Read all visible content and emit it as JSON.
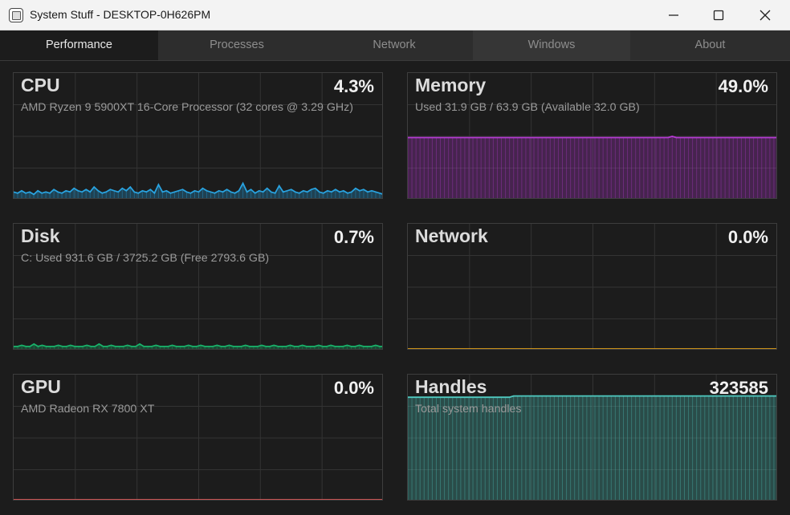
{
  "window": {
    "title": "System Stuff - DESKTOP-0H626PM"
  },
  "tabs": [
    {
      "label": "Performance",
      "active": true
    },
    {
      "label": "Processes"
    },
    {
      "label": "Network"
    },
    {
      "label": "Windows"
    },
    {
      "label": "About"
    }
  ],
  "panels": {
    "cpu": {
      "title": "CPU",
      "value": "4.3%",
      "subtitle": "AMD Ryzen 9 5900XT 16-Core Processor  (32 cores @ 3.29 GHz)",
      "color": "#29a3e0",
      "series": [
        5,
        4,
        6,
        4,
        5,
        3,
        6,
        4,
        5,
        4,
        7,
        5,
        4,
        6,
        5,
        8,
        6,
        5,
        7,
        5,
        9,
        6,
        4,
        5,
        7,
        6,
        5,
        8,
        6,
        9,
        5,
        4,
        6,
        5,
        7,
        4,
        11,
        5,
        6,
        4,
        5,
        6,
        7,
        5,
        4,
        6,
        5,
        8,
        6,
        5,
        4,
        6,
        5,
        7,
        5,
        4,
        6,
        12,
        5,
        7,
        4,
        6,
        5,
        8,
        5,
        4,
        10,
        5,
        6,
        7,
        5,
        4,
        6,
        5,
        7,
        8,
        5,
        4,
        6,
        5,
        7,
        5,
        6,
        4,
        5,
        8,
        6,
        7,
        5,
        6,
        5,
        4,
        3
      ]
    },
    "memory": {
      "title": "Memory",
      "value": "49.0%",
      "subtitle": "Used 31.9 GB / 63.9 GB  (Available 32.0 GB)",
      "color": "#b43ad2",
      "series": [
        49,
        49,
        49,
        49,
        49,
        49,
        49,
        49,
        49,
        49,
        49,
        49,
        49,
        49,
        49,
        49,
        49,
        49,
        49,
        49,
        49,
        49,
        49,
        49,
        49,
        49,
        49,
        49,
        49,
        49,
        49,
        49,
        49,
        49,
        49,
        49,
        49,
        49,
        49,
        49,
        49,
        49,
        49,
        49,
        49,
        49,
        49,
        49,
        49,
        49,
        49,
        49,
        49,
        49,
        49,
        49,
        49,
        49,
        49,
        49,
        49,
        49,
        49,
        49,
        49,
        50,
        49,
        49,
        49,
        49,
        49,
        49,
        49,
        49,
        49,
        49,
        49,
        49,
        49,
        49,
        49,
        49,
        49,
        49,
        49,
        49,
        49,
        49,
        49,
        49,
        49,
        49
      ]
    },
    "disk": {
      "title": "Disk",
      "value": "0.7%",
      "subtitle": "C:  Used 931.6 GB / 3725.2 GB  (Free 2793.6 GB)",
      "color": "#19b26a",
      "series": [
        2,
        2,
        3,
        2,
        2,
        4,
        2,
        3,
        2,
        2,
        2,
        3,
        2,
        2,
        3,
        2,
        2,
        2,
        3,
        2,
        2,
        4,
        2,
        2,
        3,
        2,
        2,
        2,
        3,
        2,
        2,
        4,
        2,
        2,
        2,
        3,
        2,
        2,
        2,
        3,
        2,
        2,
        2,
        3,
        2,
        2,
        3,
        2,
        2,
        2,
        3,
        2,
        2,
        3,
        2,
        2,
        2,
        3,
        2,
        2,
        2,
        3,
        2,
        2,
        3,
        2,
        2,
        2,
        3,
        2,
        2,
        3,
        2,
        2,
        2,
        3,
        2,
        2,
        3,
        2,
        2,
        2,
        3,
        2,
        2,
        3,
        2,
        2,
        2,
        3,
        2,
        2
      ]
    },
    "network": {
      "title": "Network",
      "value": "0.0%",
      "subtitle": "",
      "color": "#e3a21a",
      "series": [
        0,
        0,
        0,
        0,
        0,
        0,
        0,
        0,
        0,
        0,
        0,
        0,
        0,
        0,
        0,
        0,
        0,
        0,
        0,
        0,
        0,
        0,
        0,
        0,
        0,
        0,
        0,
        0,
        0,
        0,
        0,
        0,
        0,
        0,
        0,
        0,
        0,
        0,
        0,
        0,
        0,
        0,
        0,
        0,
        0,
        0,
        0,
        0,
        0,
        0,
        0,
        0,
        0,
        0,
        0,
        0,
        0,
        0,
        0,
        0,
        0,
        0,
        0,
        0,
        0,
        0,
        0,
        0,
        0,
        0,
        0,
        0,
        0,
        0,
        0,
        0,
        0,
        0,
        0,
        0,
        0,
        0,
        0,
        0,
        0,
        0,
        0,
        0,
        0,
        0,
        0,
        0
      ]
    },
    "gpu": {
      "title": "GPU",
      "value": "0.0%",
      "subtitle": "AMD Radeon RX 7800 XT",
      "color": "#e05b5b",
      "series": [
        0,
        0,
        0,
        0,
        0,
        0,
        0,
        0,
        0,
        0,
        0,
        0,
        0,
        0,
        0,
        0,
        0,
        0,
        0,
        0,
        0,
        0,
        0,
        0,
        0,
        0,
        0,
        0,
        0,
        0,
        0,
        0,
        0,
        0,
        0,
        0,
        0,
        0,
        0,
        0,
        0,
        0,
        0,
        0,
        0,
        0,
        0,
        0,
        0,
        0,
        0,
        0,
        0,
        0,
        0,
        0,
        0,
        0,
        0,
        0,
        0,
        0,
        0,
        0,
        0,
        0,
        0,
        0,
        0,
        0,
        0,
        0,
        0,
        0,
        0,
        0,
        0,
        0,
        0,
        0,
        0,
        0,
        0,
        0,
        0,
        0,
        0,
        0,
        0,
        0,
        0,
        0
      ]
    },
    "handles": {
      "title": "Handles",
      "value": "323585",
      "subtitle": "Total system handles",
      "color": "#4fc9c0",
      "series": [
        83,
        83,
        83,
        83,
        83,
        83,
        83,
        83,
        83,
        83,
        83,
        83,
        83,
        83,
        83,
        83,
        83,
        83,
        83,
        83,
        83,
        83,
        83,
        83,
        83,
        83,
        84,
        84,
        84,
        84,
        84,
        84,
        84,
        84,
        84,
        84,
        84,
        84,
        84,
        84,
        84,
        84,
        84,
        84,
        84,
        84,
        84,
        84,
        84,
        84,
        84,
        84,
        84,
        84,
        84,
        84,
        84,
        84,
        84,
        84,
        84,
        84,
        84,
        84,
        84,
        84,
        84,
        84,
        84,
        84,
        84,
        84,
        84,
        84,
        84,
        84,
        84,
        84,
        84,
        84,
        84,
        84,
        84,
        84,
        84,
        84,
        84,
        84,
        84,
        84,
        84,
        84
      ]
    }
  }
}
